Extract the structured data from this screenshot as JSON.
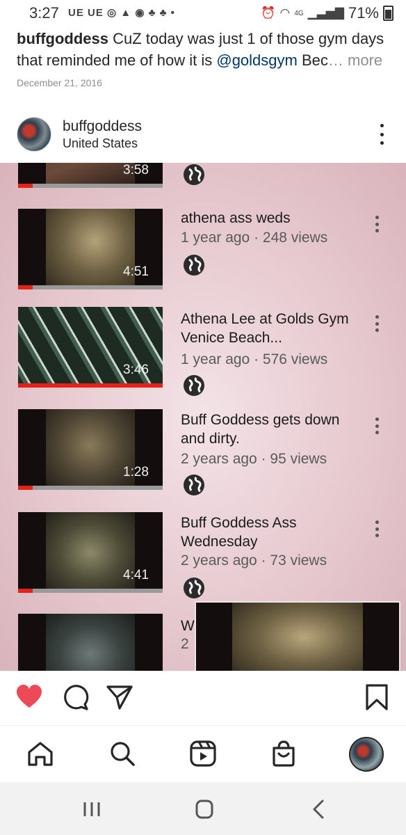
{
  "status_bar": {
    "time": "3:27",
    "notifications": "UE UE",
    "network": "4G",
    "battery": "71%"
  },
  "caption": {
    "username": "buffgoddess",
    "text": " CuZ today was just 1 of those gym days that reminded me of how it is ",
    "mention": "@goldsgym",
    "tail": " Bec",
    "ellipsis": "…",
    "more": " more"
  },
  "post_date": "December 21, 2016",
  "post_header": {
    "username": "buffgoddess",
    "location": "United States"
  },
  "videos": [
    {
      "duration": "3:58",
      "progress": 0.1
    },
    {
      "title": "athena ass weds",
      "meta": "1 year ago · 248 views",
      "duration": "4:51",
      "progress": 0.1
    },
    {
      "title": "Athena Lee at Golds Gym Venice Beach...",
      "meta": "1 year ago · 576 views",
      "duration": "3:46",
      "progress": 1.0
    },
    {
      "title": "Buff Goddess gets down and dirty.",
      "meta": "2 years ago · 95 views",
      "duration": "1:28",
      "progress": 0.1
    },
    {
      "title": "Buff Goddess Ass Wednesday",
      "meta": "2 years ago · 73 views",
      "duration": "4:41",
      "progress": 0.1
    },
    {
      "title_partial": "W",
      "meta_partial": "2"
    }
  ],
  "colors": {
    "like": "#ed4956",
    "link": "#00376b",
    "progress": "#e62117"
  },
  "icons": {
    "actions": [
      "heart-icon",
      "comment-icon",
      "share-icon",
      "bookmark-icon"
    ],
    "nav": [
      "home-icon",
      "search-icon",
      "reels-icon",
      "shop-icon",
      "profile-avatar"
    ],
    "system": [
      "recents-icon",
      "home-button-icon",
      "back-icon"
    ]
  }
}
